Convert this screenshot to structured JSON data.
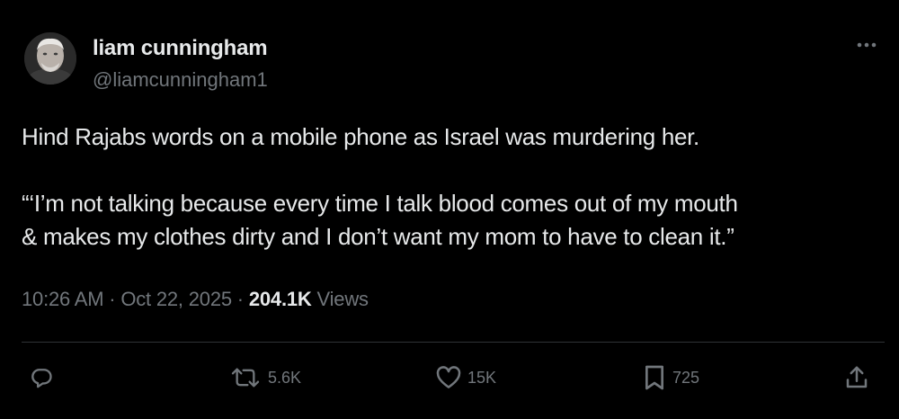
{
  "author": {
    "display_name": "liam cunningham",
    "handle": "@liamcunningham1"
  },
  "tweet": {
    "paragraphs": [
      "Hind Rajabs words on a mobile phone as Israel was murdering her.",
      "“‘I’m not talking because every time I talk blood comes out of my mouth\n& makes my clothes dirty and I don’t want my mom to have to clean it.”"
    ]
  },
  "meta": {
    "time": "10:26 AM",
    "separator": " · ",
    "date": "Oct 22, 2025",
    "views_count": "204.1K",
    "views_label": "Views"
  },
  "actions": {
    "reply": {
      "icon": "reply-icon",
      "count": ""
    },
    "retweet": {
      "icon": "retweet-icon",
      "count": "5.6K"
    },
    "like": {
      "icon": "heart-icon",
      "count": "15K"
    },
    "bookmark": {
      "icon": "bookmark-icon",
      "count": "725"
    },
    "share": {
      "icon": "share-icon",
      "count": ""
    }
  },
  "colors": {
    "background": "#000000",
    "primary_text": "#e7e9ea",
    "secondary_text": "#71767b",
    "divider": "#2f3336"
  }
}
